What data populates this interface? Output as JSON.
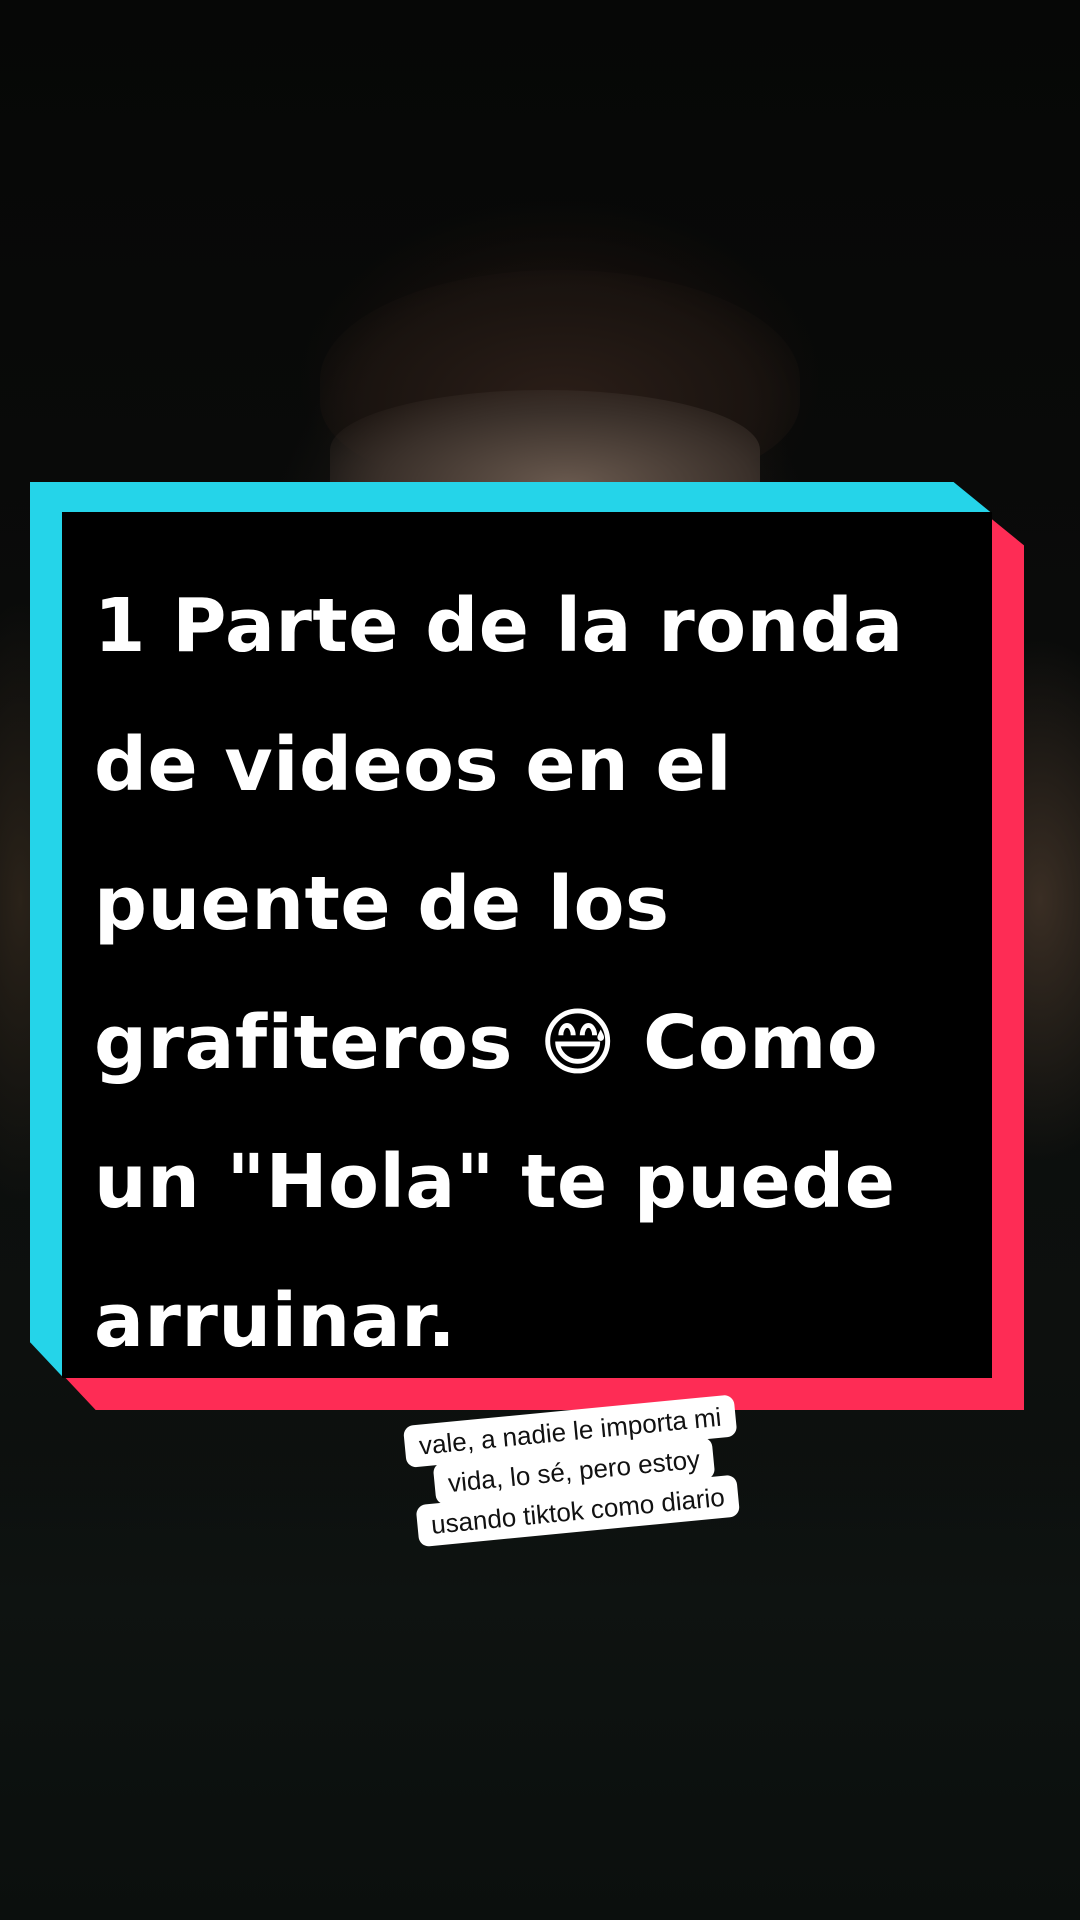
{
  "caption": {
    "text": "1 Parte de la ronda\nde videos en el\npuente de los\ngrafiteros 😅 Como\nun \"Hola\" te puede\narruinar."
  },
  "sticker": {
    "lines": [
      "vale, a nadie le importa mi",
      "vida, lo sé, pero estoy",
      "usando tiktok como diario"
    ]
  },
  "colors": {
    "cyan_accent": "#25d4e9",
    "red_accent": "#fe2c55",
    "caption_bg": "#000000",
    "caption_text": "#ffffff"
  }
}
